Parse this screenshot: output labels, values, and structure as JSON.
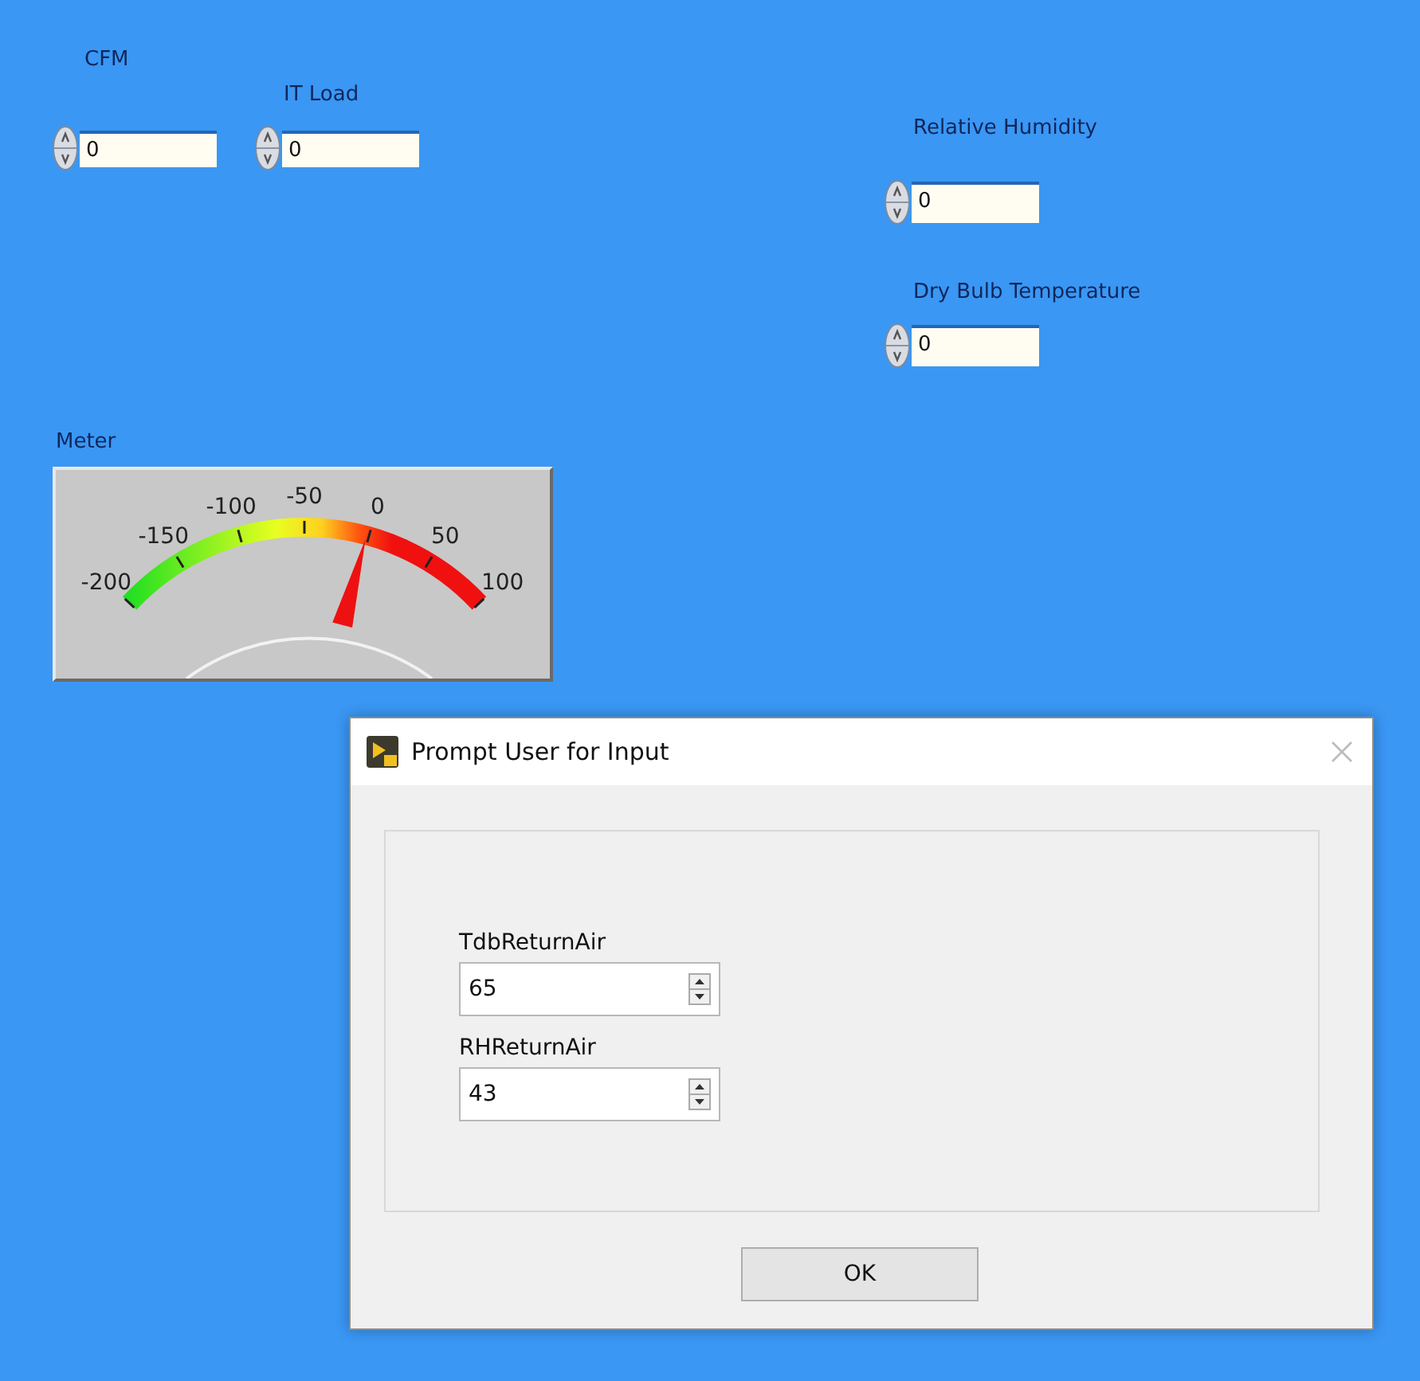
{
  "panel_controls": [
    {
      "label": "CFM",
      "value": "0"
    },
    {
      "label": "IT Load",
      "value": "0"
    },
    {
      "label": "Relative Humidity",
      "value": "0"
    },
    {
      "label": "Dry Bulb Temperature",
      "value": "0"
    }
  ],
  "meter": {
    "label": "Meter",
    "scale": [
      "-200",
      "-150",
      "-100",
      "-50",
      "0",
      "50",
      "100"
    ],
    "level": 0.66
  },
  "dialog": {
    "title": "Prompt User for Input",
    "fields": [
      {
        "label": "TdbReturnAir",
        "value": "65"
      },
      {
        "label": "RHReturnAir",
        "value": "43"
      }
    ],
    "buttons": [
      "OK"
    ]
  }
}
